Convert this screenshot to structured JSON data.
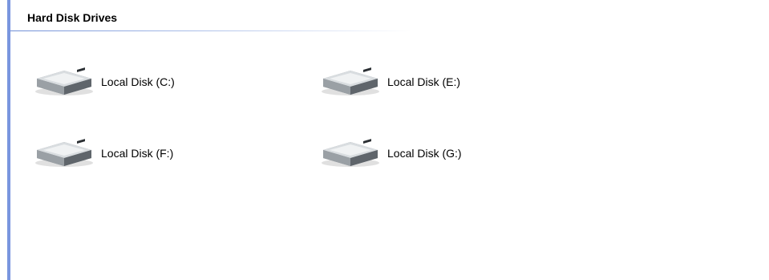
{
  "group": {
    "title": "Hard Disk Drives"
  },
  "drives": [
    {
      "label": "Local Disk (C:)",
      "icon": "hard-drive-icon"
    },
    {
      "label": "Local Disk (E:)",
      "icon": "hard-drive-icon"
    },
    {
      "label": "Local Disk (F:)",
      "icon": "hard-drive-icon"
    },
    {
      "label": "Local Disk (G:)",
      "icon": "hard-drive-icon"
    }
  ],
  "colors": {
    "rail": "#7a96df",
    "underline": "#6f8ed6",
    "text": "#000000",
    "background": "#ffffff"
  }
}
